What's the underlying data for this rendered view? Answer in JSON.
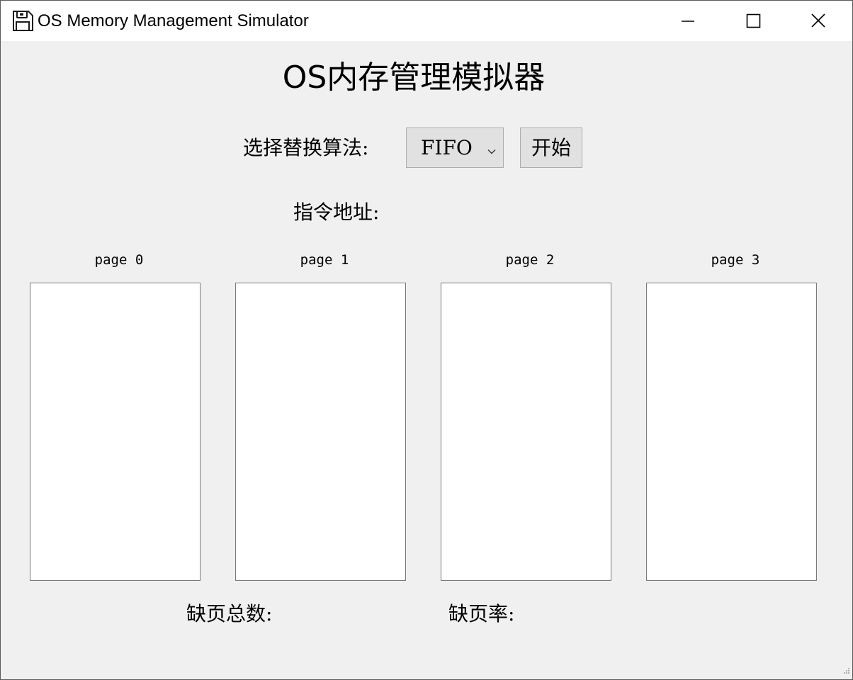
{
  "window": {
    "title": "OS Memory Management Simulator",
    "app_icon": "floppy-disk-icon",
    "controls": [
      "minimize-icon",
      "maximize-icon",
      "close-icon"
    ]
  },
  "main": {
    "heading": "OS内存管理模拟器",
    "algorithm_label": "选择替换算法:",
    "algorithm_selected": "FIFO",
    "start_button": "开始",
    "address_label": "指令地址:",
    "pages": [
      {
        "label": "page 0"
      },
      {
        "label": "page 1"
      },
      {
        "label": "page 2"
      },
      {
        "label": "page 3"
      }
    ],
    "page_fault_count_label": "缺页总数:",
    "page_fault_rate_label": "缺页率:"
  }
}
